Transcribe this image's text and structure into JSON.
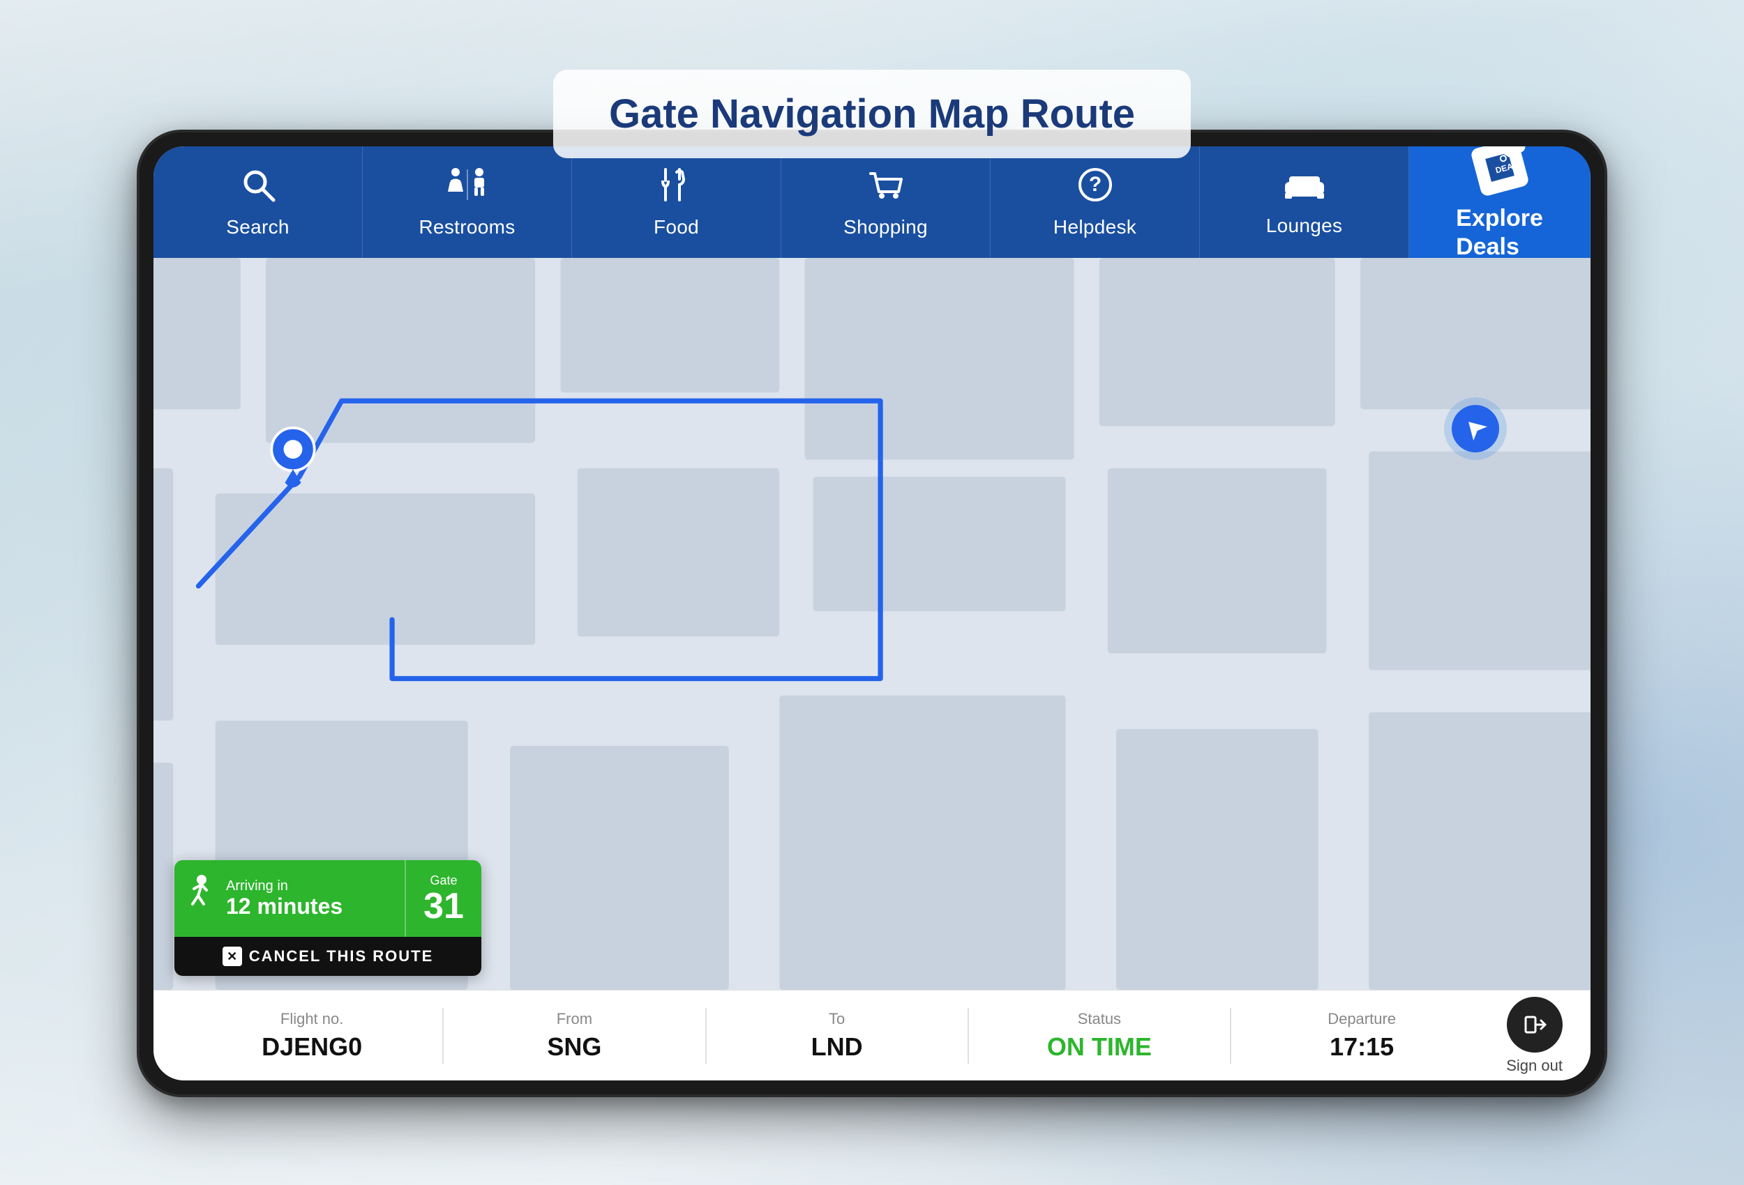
{
  "page": {
    "title": "Gate Navigation Map Route"
  },
  "navbar": {
    "items": [
      {
        "id": "search",
        "label": "Search",
        "icon": "🔍"
      },
      {
        "id": "restrooms",
        "label": "Restrooms",
        "icon": "🚻"
      },
      {
        "id": "food",
        "label": "Food",
        "icon": "🍽"
      },
      {
        "id": "shopping",
        "label": "Shopping",
        "icon": "🛒"
      },
      {
        "id": "helpdesk",
        "label": "Helpdesk",
        "icon": "❓"
      },
      {
        "id": "lounges",
        "label": "Lounges",
        "icon": "🛋"
      }
    ],
    "explore_deals_label": "Explore\nDeals",
    "explore_deals_tag": "DEAL"
  },
  "navigation": {
    "arriving_label": "Arriving in",
    "arriving_time": "12 minutes",
    "gate_label": "Gate",
    "gate_number": "31",
    "cancel_label": "CANCEL THIS ROUTE"
  },
  "flight": {
    "flight_no_label": "Flight no.",
    "flight_no": "DJENG0",
    "from_label": "From",
    "from": "SNG",
    "to_label": "To",
    "to": "LND",
    "status_label": "Status",
    "status": "ON TIME",
    "departure_label": "Departure",
    "departure": "17:15",
    "sign_out_label": "Sign out"
  }
}
